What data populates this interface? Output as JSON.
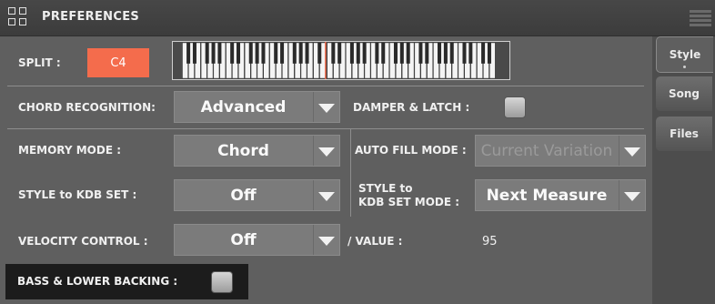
{
  "header": {
    "title": "PREFERENCES"
  },
  "split": {
    "label": "SPLIT :",
    "value": "C4"
  },
  "chord_recognition": {
    "label": "CHORD RECOGNITION:",
    "value": "Advanced"
  },
  "damper_latch": {
    "label": "DAMPER & LATCH :",
    "checked": false
  },
  "memory_mode": {
    "label": "MEMORY MODE :",
    "value": "Chord"
  },
  "auto_fill_mode": {
    "label": "AUTO FILL MODE :",
    "value": "Current Variation",
    "enabled": false
  },
  "style_kdb_set": {
    "label": "STYLE to KDB SET :",
    "value": "Off"
  },
  "style_kdb_set_mode": {
    "label_line1": "STYLE to",
    "label_line2": "KDB SET MODE :",
    "value": "Next Measure"
  },
  "velocity_control": {
    "label": "VELOCITY CONTROL :",
    "value": "Off"
  },
  "velocity_value": {
    "label": "/ VALUE :",
    "value": "95"
  },
  "bass_lower_backing": {
    "label": "BASS & LOWER BACKING :",
    "checked": false
  },
  "tabs": [
    {
      "label": "Style",
      "active": true
    },
    {
      "label": "Song",
      "active": false
    },
    {
      "label": "Files",
      "active": false
    }
  ]
}
